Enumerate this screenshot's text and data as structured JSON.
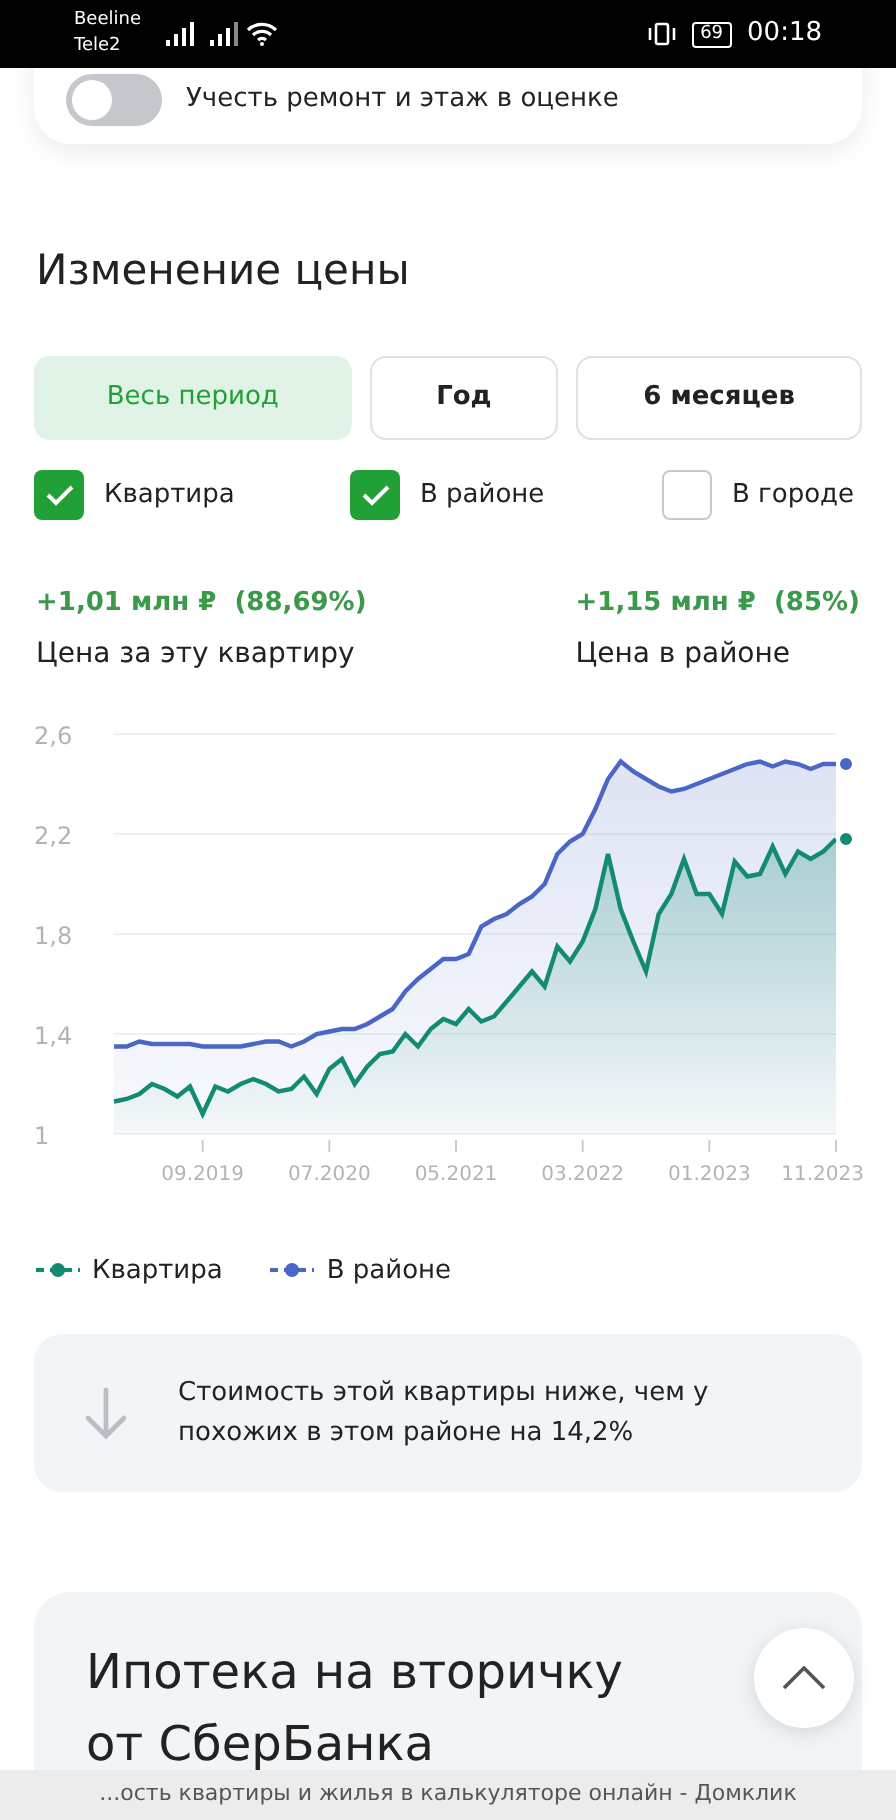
{
  "status_bar": {
    "carriers": [
      "Beeline",
      "Tele2"
    ],
    "battery": "69",
    "time": "00:18"
  },
  "repair_toggle": {
    "label": "Учесть ремонт и этаж в оценке",
    "on": false
  },
  "section_title": "Изменение цены",
  "periods": [
    {
      "label": "Весь период",
      "selected": true
    },
    {
      "label": "Год",
      "selected": false
    },
    {
      "label": "6 месяцев",
      "selected": false
    }
  ],
  "filters": [
    {
      "label": "Квартира",
      "checked": true
    },
    {
      "label": "В районе",
      "checked": true
    },
    {
      "label": "В городе",
      "checked": false
    }
  ],
  "stats": [
    {
      "change": "+1,01 млн ₽  (88,69%)",
      "label": "Цена за эту квартиру"
    },
    {
      "change": "+1,15 млн ₽  (85%)",
      "label": "Цена в районе"
    }
  ],
  "chart_data": {
    "type": "area",
    "categories": [
      null,
      null,
      null,
      null,
      null,
      null,
      null,
      "09.2019",
      null,
      null,
      null,
      null,
      null,
      null,
      null,
      null,
      null,
      "07.2020",
      null,
      null,
      null,
      null,
      null,
      null,
      null,
      null,
      null,
      "05.2021",
      null,
      null,
      null,
      null,
      null,
      null,
      null,
      null,
      null,
      "03.2022",
      null,
      null,
      null,
      null,
      null,
      null,
      null,
      null,
      null,
      "01.2023",
      null,
      null,
      null,
      null,
      null,
      null,
      null,
      null,
      null,
      "11.2023"
    ],
    "series": [
      {
        "name": "Квартира",
        "color": "#138a72",
        "values": [
          1.13,
          1.14,
          1.16,
          1.2,
          1.18,
          1.15,
          1.19,
          1.08,
          1.19,
          1.17,
          1.2,
          1.22,
          1.2,
          1.17,
          1.18,
          1.23,
          1.16,
          1.26,
          1.3,
          1.2,
          1.27,
          1.32,
          1.33,
          1.4,
          1.35,
          1.42,
          1.46,
          1.44,
          1.5,
          1.45,
          1.47,
          1.53,
          1.59,
          1.65,
          1.59,
          1.75,
          1.69,
          1.77,
          1.9,
          2.12,
          1.9,
          1.77,
          1.65,
          1.88,
          1.96,
          2.1,
          1.96,
          1.96,
          1.88,
          2.09,
          2.03,
          2.04,
          2.15,
          2.04,
          2.13,
          2.1,
          2.13,
          2.18
        ]
      },
      {
        "name": "В районе",
        "color": "#4a67c7",
        "values": [
          1.35,
          1.35,
          1.37,
          1.36,
          1.36,
          1.36,
          1.36,
          1.35,
          1.35,
          1.35,
          1.35,
          1.36,
          1.37,
          1.37,
          1.35,
          1.37,
          1.4,
          1.41,
          1.42,
          1.42,
          1.44,
          1.47,
          1.5,
          1.57,
          1.62,
          1.66,
          1.7,
          1.7,
          1.72,
          1.83,
          1.86,
          1.88,
          1.92,
          1.95,
          2.0,
          2.12,
          2.17,
          2.2,
          2.3,
          2.42,
          2.49,
          2.45,
          2.42,
          2.39,
          2.37,
          2.38,
          2.4,
          2.42,
          2.44,
          2.46,
          2.48,
          2.49,
          2.47,
          2.49,
          2.48,
          2.46,
          2.48,
          2.48
        ]
      }
    ],
    "ylim": [
      1,
      2.6
    ],
    "grid": true,
    "yticks": [
      {
        "value": 1,
        "label": "1"
      },
      {
        "value": 1.4,
        "label": "1,4"
      },
      {
        "value": 1.8,
        "label": "1,8"
      },
      {
        "value": 2.2,
        "label": "2,2"
      },
      {
        "value": 2.6,
        "label": "2,6"
      }
    ]
  },
  "info_note": "Стоимость этой квартиры ниже, чем у похожих в этом районе на 14,2%",
  "mortgage_title": "Ипотека на вторичку от СберБанка",
  "url_bar": "...ость квартиры и жилья в калькуляторе онлайн - Домклик"
}
